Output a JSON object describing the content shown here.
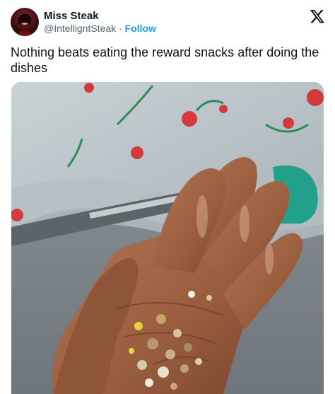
{
  "author": {
    "display_name": "Miss Steak",
    "handle": "@IntelligntSteak",
    "separator": "·",
    "follow_label": "Follow"
  },
  "tweet": {
    "text": "Nothing beats eating the reward snacks after doing the dishes"
  },
  "icons": {
    "avatar": "profile-avatar",
    "platform_logo": "x-logo-icon"
  },
  "colors": {
    "link": "#1d9bf0",
    "text_primary": "#0f1419",
    "text_secondary": "#536471"
  }
}
